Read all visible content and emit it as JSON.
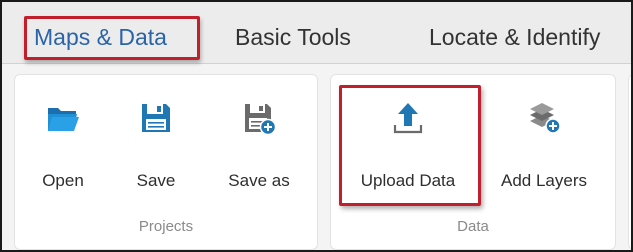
{
  "tabs": [
    {
      "label": "Maps & Data",
      "active": true
    },
    {
      "label": "Basic Tools",
      "active": false
    },
    {
      "label": "Locate & Identify",
      "active": false
    }
  ],
  "groups": {
    "projects": {
      "label": "Projects",
      "tools": [
        {
          "label": "Open",
          "icon": "folder-open-icon"
        },
        {
          "label": "Save",
          "icon": "floppy-save-icon"
        },
        {
          "label": "Save as",
          "icon": "floppy-save-as-icon"
        }
      ]
    },
    "data": {
      "label": "Data",
      "tools": [
        {
          "label": "Upload Data",
          "icon": "upload-icon"
        },
        {
          "label": "Add Layers",
          "icon": "add-layers-icon"
        }
      ]
    }
  },
  "colors": {
    "accent_blue": "#1f78b4",
    "active_tab_text": "#2a64a8",
    "highlight_red": "#c01f2b",
    "icon_gray": "#6b6b6b"
  }
}
